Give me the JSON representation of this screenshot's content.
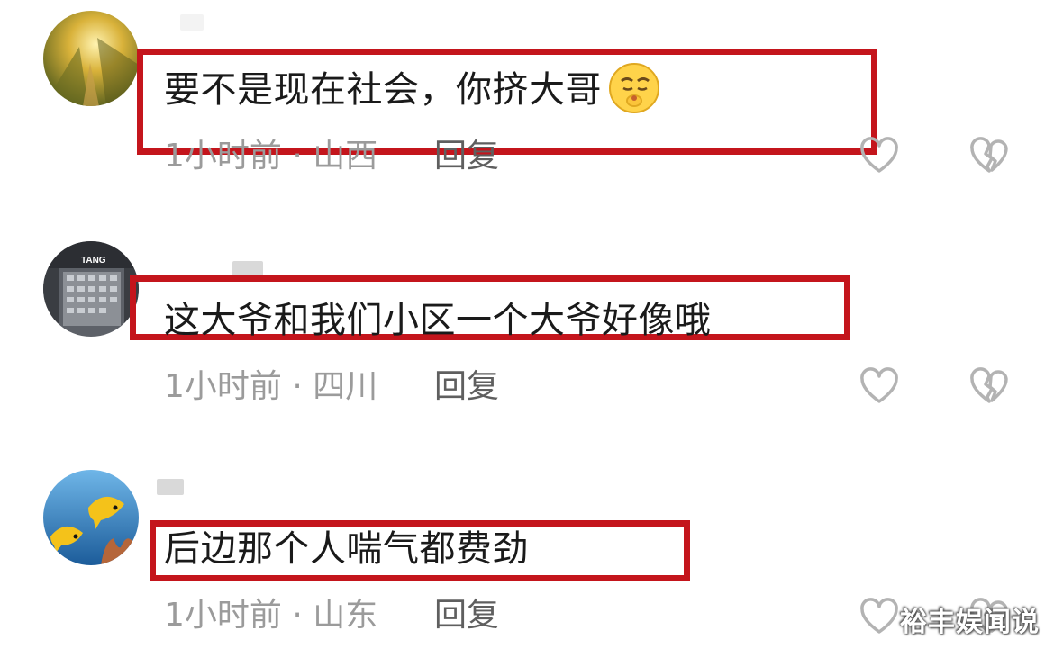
{
  "comments": [
    {
      "text": "要不是现在社会，你挤大哥",
      "time": "1小时前",
      "separator": "·",
      "location": "山西",
      "reply_label": "回复",
      "emoji": "shushing-face-emoji"
    },
    {
      "text": "这大爷和我们小区一个大爷好像哦",
      "time": "1小时前",
      "separator": "·",
      "location": "四川",
      "reply_label": "回复"
    },
    {
      "text": "后边那个人喘气都费劲",
      "time": "1小时前",
      "separator": "·",
      "location": "山东",
      "reply_label": "回复"
    }
  ],
  "icons": {
    "like": "heart-outline-icon",
    "dislike": "broken-heart-icon"
  },
  "colors": {
    "highlight_box": "#c4151c",
    "meta_text": "#9b9b9b",
    "reply_text": "#5f5f5f",
    "icon_stroke": "#b3b3b3"
  },
  "watermark": "裕丰娱闻说"
}
